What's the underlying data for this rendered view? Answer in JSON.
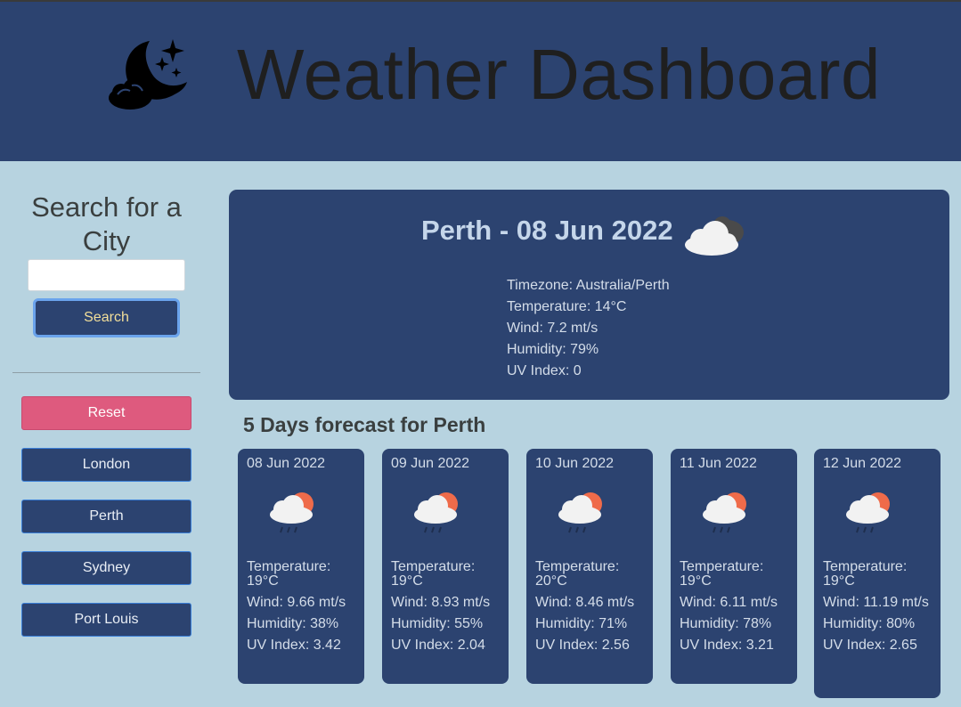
{
  "header": {
    "title": "Weather Dashboard",
    "logo_icon": "moon-stars-cloud-icon"
  },
  "sidebar": {
    "heading": "Search for a City",
    "search_placeholder": "",
    "search_value": "",
    "search_label": "Search",
    "reset_label": "Reset",
    "cities": [
      "London",
      "Perth",
      "Sydney",
      "Port Louis"
    ]
  },
  "current": {
    "title": "Perth - 08 Jun 2022",
    "icon": "cloudy-night-icon",
    "timezone": "Timezone: Australia/Perth",
    "temperature": "Temperature: 14°C",
    "wind": "Wind: 7.2 mt/s",
    "humidity": "Humidity: 79%",
    "uv": "UV Index: 0"
  },
  "forecast": {
    "heading": "5 Days forecast for Perth",
    "days": [
      {
        "date": "08 Jun 2022",
        "icon": "sun-cloud-rain-icon",
        "temperature": "Temperature: 19°C",
        "wind": "Wind: 9.66 mt/s",
        "humidity": "Humidity: 38%",
        "uv": "UV Index: 3.42"
      },
      {
        "date": "09 Jun 2022",
        "icon": "sun-cloud-rain-icon",
        "temperature": "Temperature: 19°C",
        "wind": "Wind: 8.93 mt/s",
        "humidity": "Humidity: 55%",
        "uv": "UV Index: 2.04"
      },
      {
        "date": "10 Jun 2022",
        "icon": "sun-cloud-rain-icon",
        "temperature": "Temperature: 20°C",
        "wind": "Wind: 8.46 mt/s",
        "humidity": "Humidity: 71%",
        "uv": "UV Index: 2.56"
      },
      {
        "date": "11 Jun 2022",
        "icon": "sun-cloud-rain-icon",
        "temperature": "Temperature: 19°C",
        "wind": "Wind: 6.11 mt/s",
        "humidity": "Humidity: 78%",
        "uv": "UV Index: 3.21"
      },
      {
        "date": "12 Jun 2022",
        "icon": "sun-cloud-rain-icon",
        "temperature": "Temperature: 19°C",
        "wind": "Wind: 11.19 mt/s",
        "humidity": "Humidity: 80%",
        "uv": "UV Index: 2.65"
      }
    ]
  },
  "colors": {
    "page_bg": "#b7d3e0",
    "header_bg": "#2c4370",
    "card_bg": "#2c4370",
    "reset": "#de5a7e",
    "accent_border": "#6aa3ec",
    "search_text": "#f3df9a"
  }
}
